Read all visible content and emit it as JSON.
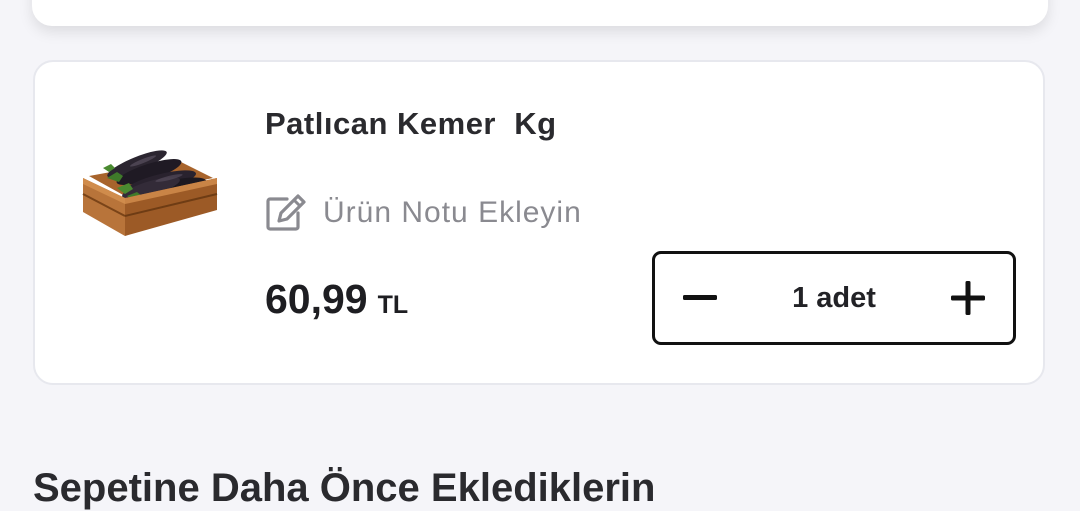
{
  "cart_item": {
    "name": "Patlıcan Kemer  Kg",
    "image_icon": "eggplant-crate-product-image",
    "note_icon": "edit-note-icon",
    "note_label": "Ürün Notu Ekleyin",
    "price": "60,99",
    "currency": "TL",
    "quantity_label": "1 adet",
    "minus_icon": "minus-icon",
    "plus_icon": "plus-icon"
  },
  "sections": {
    "previously_added_title": "Sepetine Daha Önce Eklediklerin"
  },
  "colors": {
    "page_background": "#f5f5f9",
    "card_background": "#ffffff",
    "card_border": "#e7e8ee",
    "text_primary": "#2a2a2e",
    "text_muted": "#8a8a90",
    "stepper_border": "#111111"
  }
}
